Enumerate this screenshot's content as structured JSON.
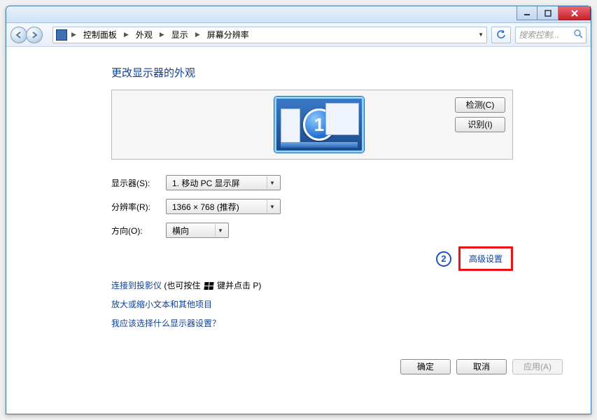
{
  "titlebar": {
    "min": "–",
    "max": "▢",
    "close": "✕"
  },
  "breadcrumb": {
    "items": [
      "控制面板",
      "外观",
      "显示",
      "屏幕分辨率"
    ]
  },
  "addressbar": {
    "refresh_tip": "刷新",
    "search_placeholder": "搜索控制..."
  },
  "heading": "更改显示器的外观",
  "preview": {
    "monitor_badge": "1",
    "detect_btn": "检测(C)",
    "identify_btn": "识别(I)"
  },
  "form": {
    "display_label": "显示器(S):",
    "display_value": "1. 移动 PC 显示屏",
    "resolution_label": "分辨率(R):",
    "resolution_value": "1366 × 768 (推荐)",
    "orientation_label": "方向(O):",
    "orientation_value": "横向"
  },
  "advanced": {
    "step_badge": "2",
    "link_text": "高级设置"
  },
  "help_links": {
    "projector_link": "连接到投影仪",
    "projector_note_1": " (也可按住 ",
    "projector_note_2": " 键并点击 P)",
    "zoom_text": "放大或缩小文本和其他项目",
    "which_settings": "我应该选择什么显示器设置？"
  },
  "footer": {
    "ok": "确定",
    "cancel": "取消",
    "apply": "应用(A)"
  }
}
